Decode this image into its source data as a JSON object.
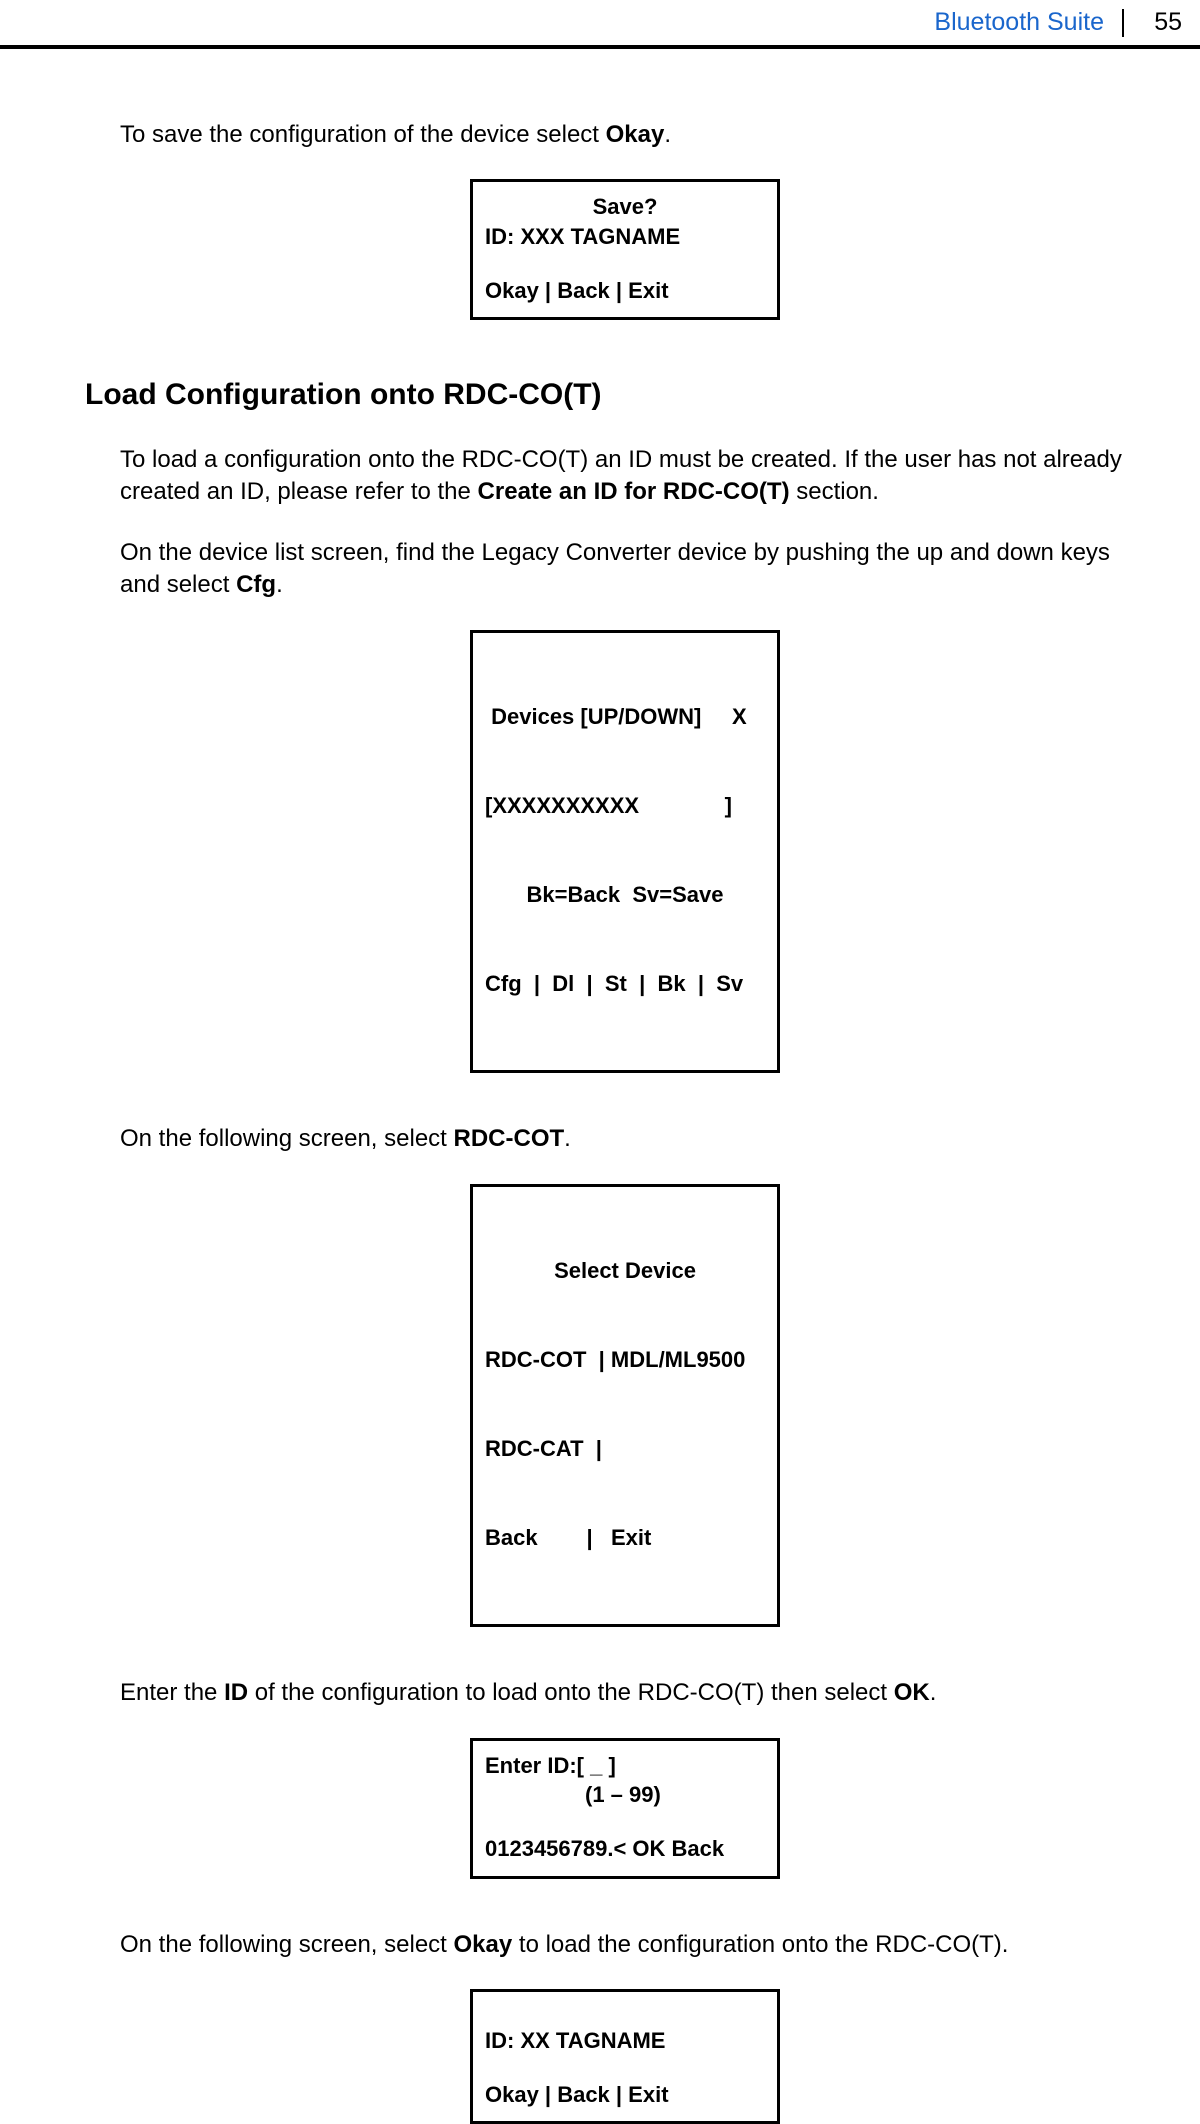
{
  "header": {
    "title": "Bluetooth Suite",
    "page_number": "55"
  },
  "paragraphs": {
    "p1a": "To save the configuration of the device select ",
    "p1b": "Okay",
    "p1c": ".",
    "sectionHeading": "Load Configuration onto RDC-CO(T)",
    "p2a": "To load a configuration onto the RDC-CO(T) an ID must be created. If the user has not already created an ID, please refer to the ",
    "p2b": "Create an ID for RDC-CO(T)",
    "p2c": " section.",
    "p3a": "On the device list screen, find the Legacy Converter device by pushing the up and down keys and select ",
    "p3b": "Cfg",
    "p3c": ".",
    "p4a": "On the following screen, select ",
    "p4b": "RDC-COT",
    "p4c": ".",
    "p5a": "Enter the ",
    "p5b": "ID",
    "p5c": " of the configuration to load onto the RDC-CO(T) then select ",
    "p5d": "OK",
    "p5e": ".",
    "p6a": "On the following screen, select ",
    "p6b": "Okay",
    "p6c": " to load the configuration onto the RDC-CO(T)."
  },
  "screens": {
    "save": {
      "l1": "Save?",
      "l2": "ID: XXX   TAGNAME",
      "l3": "Okay  |  Back  |  Exit"
    },
    "devices": {
      "l1": " Devices [UP/DOWN]     X",
      "l2": "[XXXXXXXXXX              ]",
      "l3": "Bk=Back  Sv=Save",
      "l4": "Cfg  |  Dl  |  St  |  Bk  |  Sv"
    },
    "selectDevice": {
      "l1": "Select Device",
      "l2": "RDC-COT  | MDL/ML9500",
      "l3": "RDC-CAT  |",
      "l4": "Back        |   Exit"
    },
    "enterId": {
      "l1": "Enter ID:[ _     ]",
      "l2": "(1 – 99)",
      "l3": "0123456789.<  OK   Back"
    },
    "loadConfirm": {
      "l1": "ID: XX  TAGNAME",
      "l2": "Okay  |  Back  |  Exit"
    }
  }
}
